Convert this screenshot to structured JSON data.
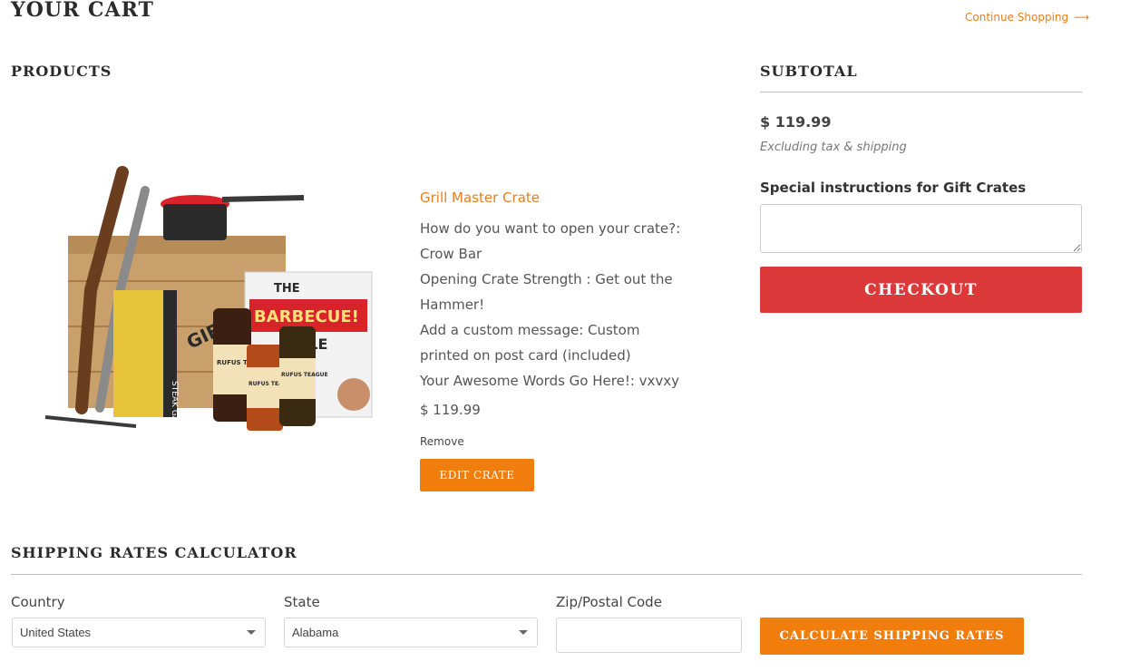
{
  "header": {
    "title": "YOUR CART",
    "continue_label": "Continue Shopping",
    "continue_arrow": "⟶"
  },
  "products": {
    "heading": "PRODUCTS",
    "items": [
      {
        "title": "Grill Master Crate",
        "options": [
          "How do you want to open your crate?:",
          "Crow Bar",
          "Opening Crate Strength : Get out the",
          "Hammer!",
          "Add a custom message: Custom",
          "printed on post card (included)",
          "Your Awesome Words Go Here!: vxvxy"
        ],
        "price": "$ 119.99",
        "remove_label": "Remove",
        "edit_label": "EDIT CRATE",
        "image_text": {
          "book_the": "THE",
          "book_title": "BARBECUE!",
          "book_bible": "BIBLE",
          "sauce_1": "RUFUS TEAGUE",
          "sauce_2": "RUFUS TEAGUE",
          "sauce_3": "RUFUS TEAGUE",
          "gauge": "STEAK GAUGE",
          "crate": "GIFT CRATE"
        }
      }
    ]
  },
  "summary": {
    "heading": "SUBTOTAL",
    "amount": "$ 119.99",
    "note": "Excluding tax & shipping",
    "instructions_label": "Special instructions for Gift Crates",
    "instructions_value": "",
    "checkout_label": "CHECKOUT"
  },
  "shipping": {
    "heading": "SHIPPING RATES CALCULATOR",
    "country_label": "Country",
    "country_value": "United States",
    "state_label": "State",
    "state_value": "Alabama",
    "zip_label": "Zip/Postal Code",
    "zip_value": "",
    "calculate_label": "CALCULATE SHIPPING RATES"
  },
  "colors": {
    "accent_orange": "#f07d0c",
    "link_orange": "#e67e1f",
    "checkout_red": "#dc3a3a"
  }
}
